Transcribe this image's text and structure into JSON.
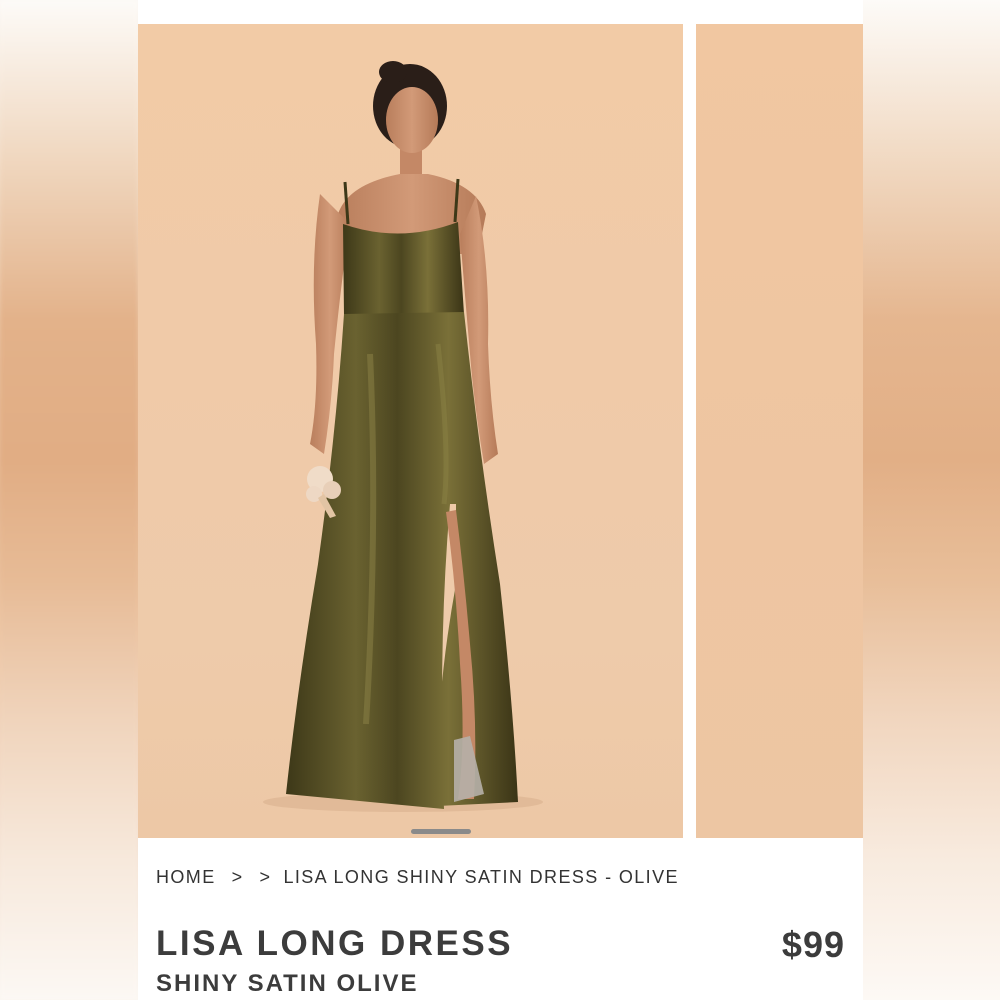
{
  "breadcrumb": {
    "home": "HOME",
    "separator": ">",
    "current": "LISA LONG SHINY SATIN DRESS - OLIVE"
  },
  "product": {
    "title": "LISA LONG DRESS",
    "subtitle": "SHINY SATIN OLIVE",
    "price": "$99"
  },
  "gallery": {
    "slides_visible": 2,
    "active_index": 0
  },
  "colors": {
    "backdrop": "#f0cba8",
    "dress": "#4a4420",
    "text": "#3c3c3c"
  }
}
